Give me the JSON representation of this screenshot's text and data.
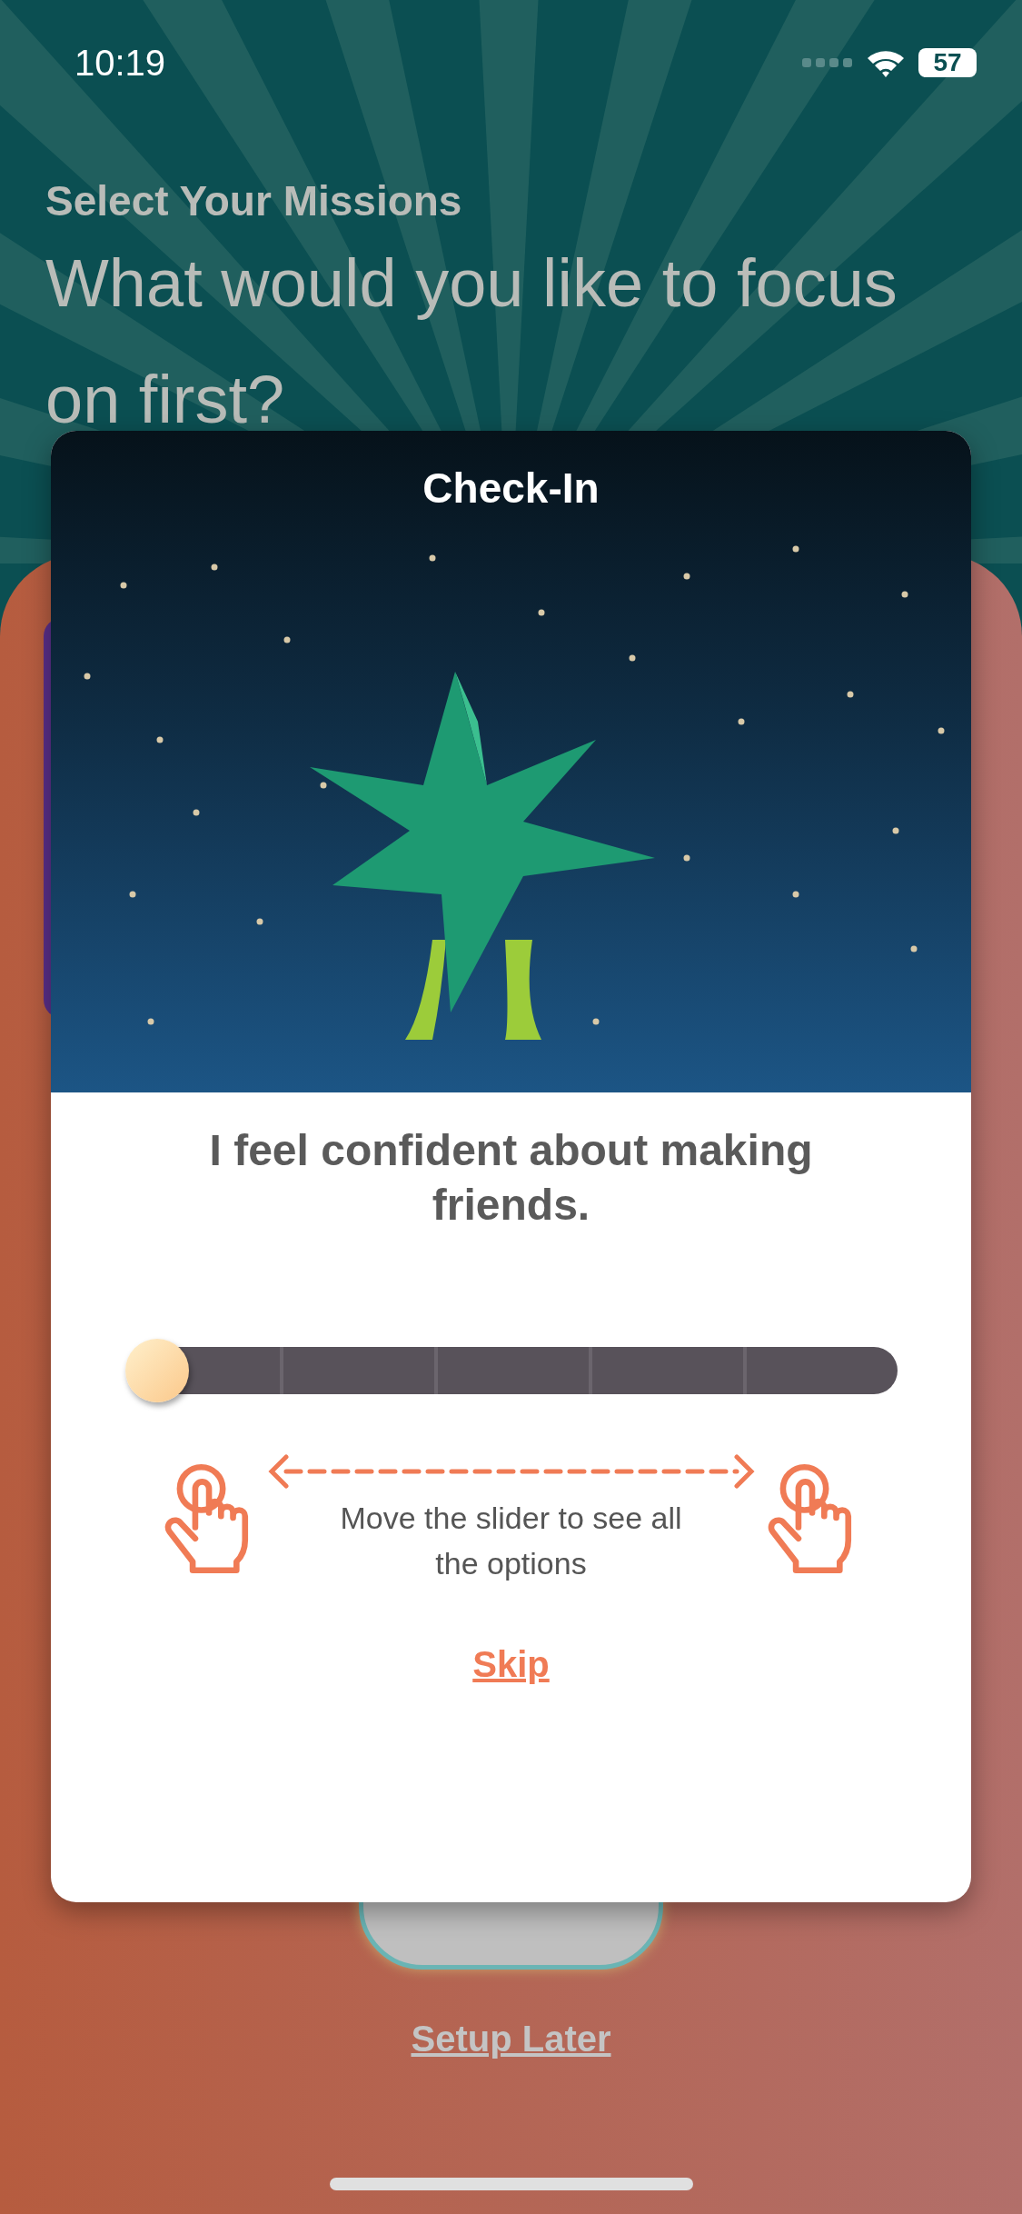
{
  "status_bar": {
    "time": "10:19",
    "battery": "57"
  },
  "header": {
    "eyebrow": "Select Your Missions",
    "title": "What would you like to focus on first?"
  },
  "background": {
    "link": "Setup Later"
  },
  "dialog": {
    "title": "Check-In",
    "statement": "I feel confident about making friends.",
    "slider": {
      "level": 0
    },
    "hint": "Move the slider to see all the options",
    "skip": "Skip"
  }
}
